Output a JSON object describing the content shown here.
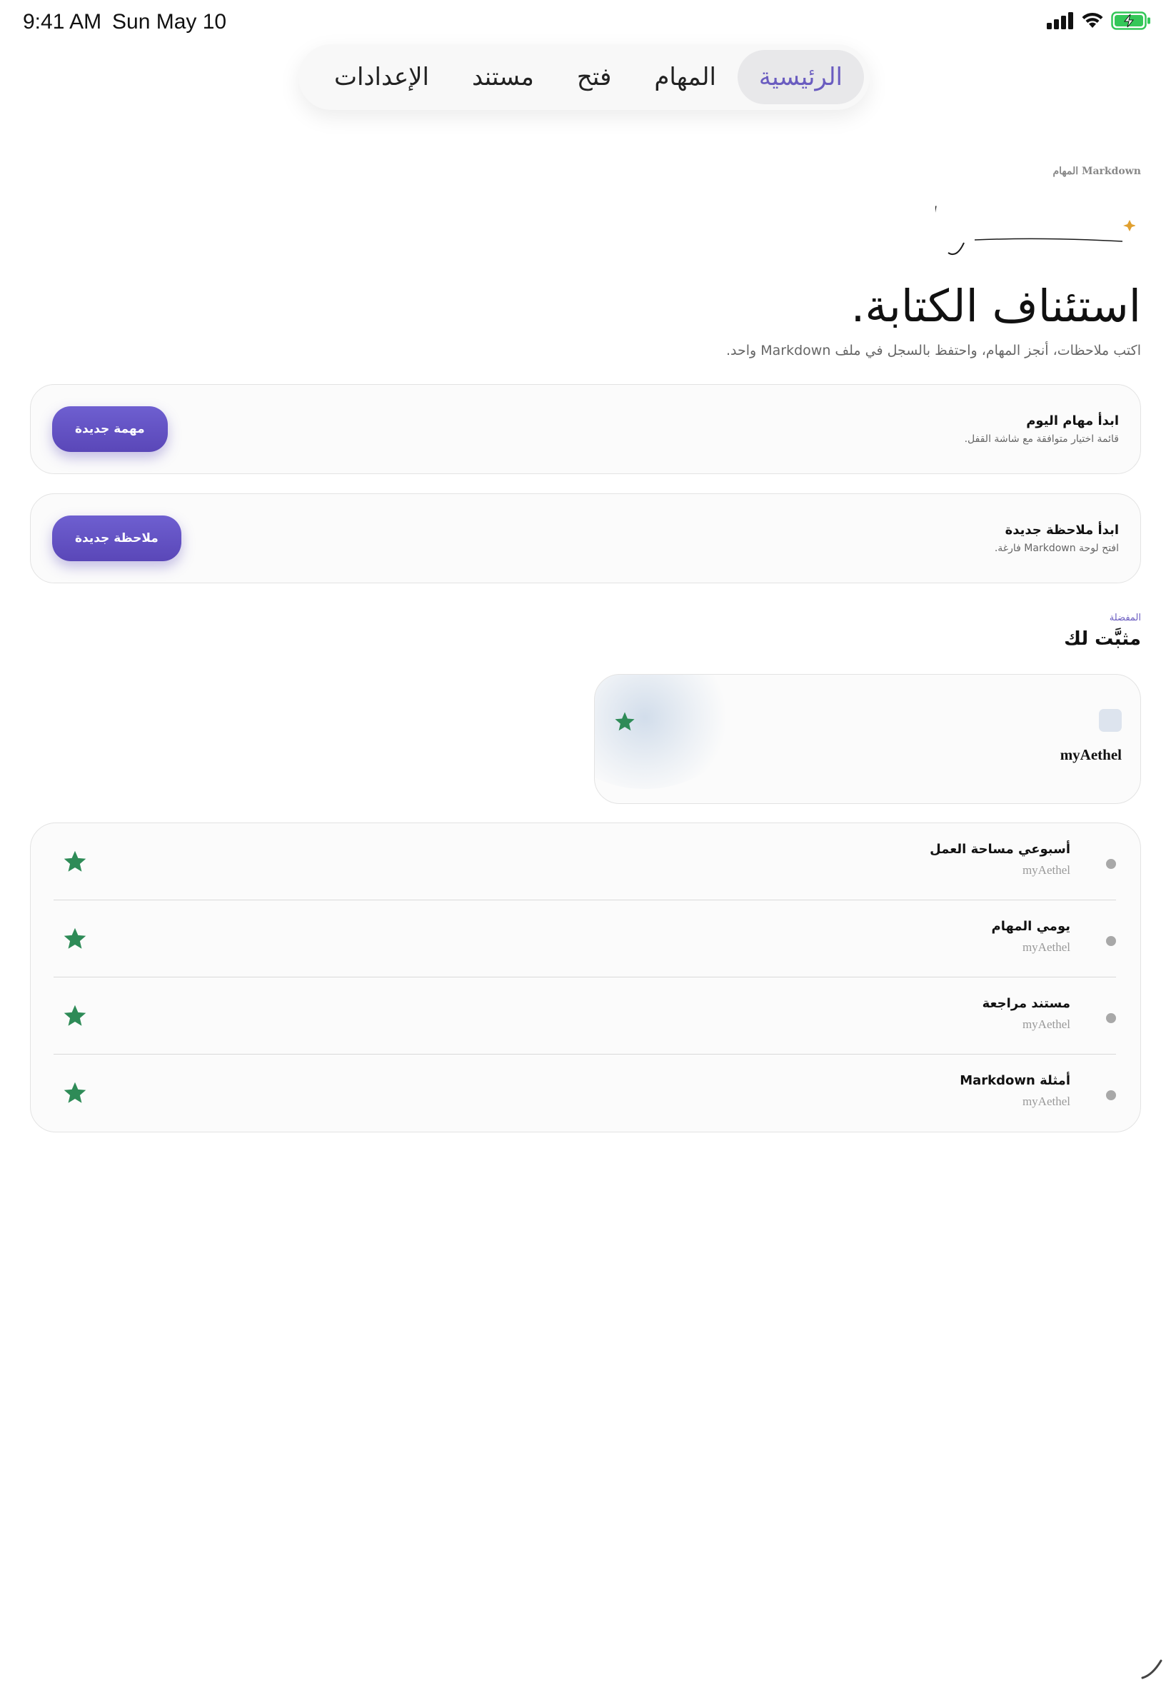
{
  "status_bar": {
    "time": "9:41 AM",
    "date": "Sun May 10",
    "icons": [
      "signal-icon",
      "wifi-icon",
      "battery-charging-icon"
    ]
  },
  "tabs": [
    {
      "label": "الرئيسية",
      "active": true
    },
    {
      "label": "المهام",
      "active": false
    },
    {
      "label": "فتح",
      "active": false
    },
    {
      "label": "مستند",
      "active": false
    },
    {
      "label": "الإعدادات",
      "active": false
    }
  ],
  "header": {
    "breadcrumb": "Markdown المهام",
    "logo_text": "myAethel",
    "title": "استئناف الكتابة.",
    "subtitle": "اكتب ملاحظات، أنجز المهام، واحتفظ بالسجل في ملف Markdown واحد."
  },
  "actions": [
    {
      "title": "ابدأ مهام اليوم",
      "description": "قائمة اختيار متوافقة مع شاشة القفل.",
      "button": "مهمة جديدة"
    },
    {
      "title": "ابدأ ملاحظة جديدة",
      "description": "افتح لوحة Markdown فارغة.",
      "button": "ملاحظة جديدة"
    }
  ],
  "pinned_section": {
    "kicker": "المفضلة",
    "title": "مثبَّت لك",
    "card": {
      "title": "myAethel"
    }
  },
  "list_items": [
    {
      "title": "أسبوعي مساحة العمل",
      "subtitle": "myAethel"
    },
    {
      "title": "يومي المهام",
      "subtitle": "myAethel"
    },
    {
      "title": "مستند مراجعة",
      "subtitle": "myAethel"
    },
    {
      "title": "أمثلة Markdown",
      "subtitle": "myAethel"
    }
  ],
  "colors": {
    "accent": "#6a5cc0",
    "button": "#5a47b8",
    "star": "#2e8b57",
    "logo_sparkle": "#e0a030",
    "battery": "#34c759"
  }
}
